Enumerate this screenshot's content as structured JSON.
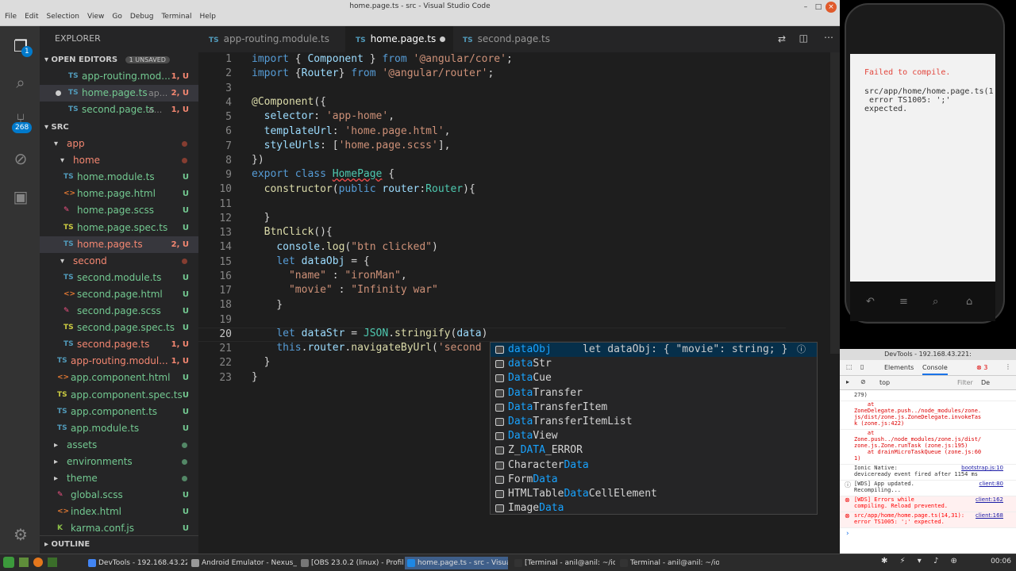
{
  "window": {
    "title": "home.page.ts - src - Visual Studio Code",
    "menu": [
      "File",
      "Edit",
      "Selection",
      "View",
      "Go",
      "Debug",
      "Terminal",
      "Help"
    ]
  },
  "activity": {
    "icons": [
      "files-icon",
      "search-icon",
      "source-control-icon",
      "debug-icon",
      "extensions-icon"
    ],
    "explorer_badge": "1",
    "scm_badge": "268"
  },
  "sidebar": {
    "title": "EXPLORER",
    "open_editors": {
      "label": "OPEN EDITORS",
      "unsaved": "1 UNSAVED",
      "items": [
        {
          "icon": "TS",
          "name": "app-routing.mod...",
          "desc": "",
          "status": "1, U"
        },
        {
          "icon": "TS",
          "name": "home.page.ts",
          "desc": "ap...",
          "status": "2, U",
          "dirty": true
        },
        {
          "icon": "TS",
          "name": "second.page.ts",
          "desc": "a...",
          "status": "1, U"
        }
      ]
    },
    "src_label": "SRC",
    "tree": [
      {
        "t": "folder",
        "name": "app",
        "indent": 1
      },
      {
        "t": "folder",
        "name": "home",
        "indent": 2
      },
      {
        "t": "TS",
        "name": "home.module.ts",
        "status": "U"
      },
      {
        "t": "html",
        "name": "home.page.html",
        "status": "U"
      },
      {
        "t": "scss",
        "name": "home.page.scss",
        "status": "U"
      },
      {
        "t": "spec",
        "name": "home.page.spec.ts",
        "status": "U"
      },
      {
        "t": "TS",
        "name": "home.page.ts",
        "status": "2, U"
      },
      {
        "t": "folder",
        "name": "second",
        "indent": 2
      },
      {
        "t": "TS",
        "name": "second.module.ts",
        "status": "U"
      },
      {
        "t": "html",
        "name": "second.page.html",
        "status": "U"
      },
      {
        "t": "scss",
        "name": "second.page.scss",
        "status": "U"
      },
      {
        "t": "spec",
        "name": "second.page.spec.ts",
        "status": "U"
      },
      {
        "t": "TS",
        "name": "second.page.ts",
        "status": "1, U"
      },
      {
        "t": "TS",
        "name": "app-routing.modul...",
        "status": "1, U"
      },
      {
        "t": "html",
        "name": "app.component.html",
        "status": "U"
      },
      {
        "t": "spec",
        "name": "app.component.spec.ts",
        "status": "U"
      },
      {
        "t": "TS",
        "name": "app.component.ts",
        "status": "U"
      },
      {
        "t": "TS",
        "name": "app.module.ts",
        "status": "U"
      },
      {
        "t": "folder",
        "name": "assets"
      },
      {
        "t": "folder",
        "name": "environments"
      },
      {
        "t": "folder",
        "name": "theme"
      },
      {
        "t": "scss",
        "name": "global.scss",
        "status": "U"
      },
      {
        "t": "html",
        "name": "index.html",
        "status": "U"
      },
      {
        "t": "k",
        "name": "karma.conf.js",
        "status": "U"
      }
    ],
    "outline": "OUTLINE"
  },
  "tabs": [
    {
      "name": "app-routing.module.ts"
    },
    {
      "name": "home.page.ts",
      "active": true
    },
    {
      "name": "second.page.ts"
    }
  ],
  "editor": {
    "lines": [
      "1",
      "2",
      "3",
      "4",
      "5",
      "6",
      "7",
      "8",
      "9",
      "10",
      "11",
      "12",
      "13",
      "14",
      "15",
      "16",
      "17",
      "18",
      "19",
      "20",
      "21",
      "22",
      "23"
    ]
  },
  "suggest": {
    "items": [
      {
        "pre": "",
        "hl": "dataObj",
        "post": "",
        "detail": "let dataObj: { \"movie\": string; }"
      },
      {
        "pre": "",
        "hl": "data",
        "post": "Str"
      },
      {
        "pre": "",
        "hl": "Data",
        "post": "Cue"
      },
      {
        "pre": "",
        "hl": "Data",
        "post": "Transfer"
      },
      {
        "pre": "",
        "hl": "Data",
        "post": "TransferItem"
      },
      {
        "pre": "",
        "hl": "Data",
        "post": "TransferItemList"
      },
      {
        "pre": "",
        "hl": "Data",
        "post": "View"
      },
      {
        "pre": "Z_",
        "hl": "DATA",
        "post": "_ERROR"
      },
      {
        "pre": "Character",
        "hl": "Data",
        "post": ""
      },
      {
        "pre": "Form",
        "hl": "Data",
        "post": ""
      },
      {
        "pre": "HTMLTable",
        "hl": "Data",
        "post": "CellElement"
      },
      {
        "pre": "Image",
        "hl": "Data",
        "post": ""
      }
    ]
  },
  "phone": {
    "failed": "Failed to compile.",
    "error": "src/app/home/home.page.ts(1\n error TS1005: ';'\nexpected."
  },
  "devtools": {
    "title": "DevTools - 192.168.43.221:",
    "tabs": [
      "Elements",
      "Console"
    ],
    "errors": "3",
    "context": "top",
    "filter": "Filter",
    "level": "De",
    "log": [
      {
        "text": "279)",
        "src": ""
      },
      {
        "text": "    at\nZoneDelegate.push../node_modules/zone.\njs/dist/zone.js.ZoneDelegate.invokeTas\nk (zone.js:422)",
        "src": ""
      },
      {
        "text": "    at\nZone.push../node_modules/zone.js/dist/\nzone.js.Zone.runTask (zone.js:195)\n    at drainMicroTaskQueue (zone.js:60\n1)",
        "src": ""
      },
      {
        "text": "Ionic Native:\ndeviceready event fired after 1154 ms",
        "src": "bootstrap.js:10"
      },
      {
        "text": "[WDS] App updated.\nRecompiling...",
        "src": "client:80"
      },
      {
        "text": "[WDS] Errors while\ncompiling. Reload prevented.",
        "src": "client:162"
      },
      {
        "text": "src/app/home/home.page.ts(14,31):\nerror TS1005: ';' expected.",
        "src": "client:168"
      }
    ]
  },
  "taskbar": {
    "items": [
      "DevTools - 192.168.43.221:8...",
      "Android Emulator - Nexus_S...",
      "[OBS 23.0.2 (linux) - Profile:...",
      "home.page.ts - src - Visua...",
      "[Terminal - anil@anil: ~/ionic...",
      "Terminal - anil@anil: ~/ionic..."
    ],
    "clock": "00:06"
  }
}
